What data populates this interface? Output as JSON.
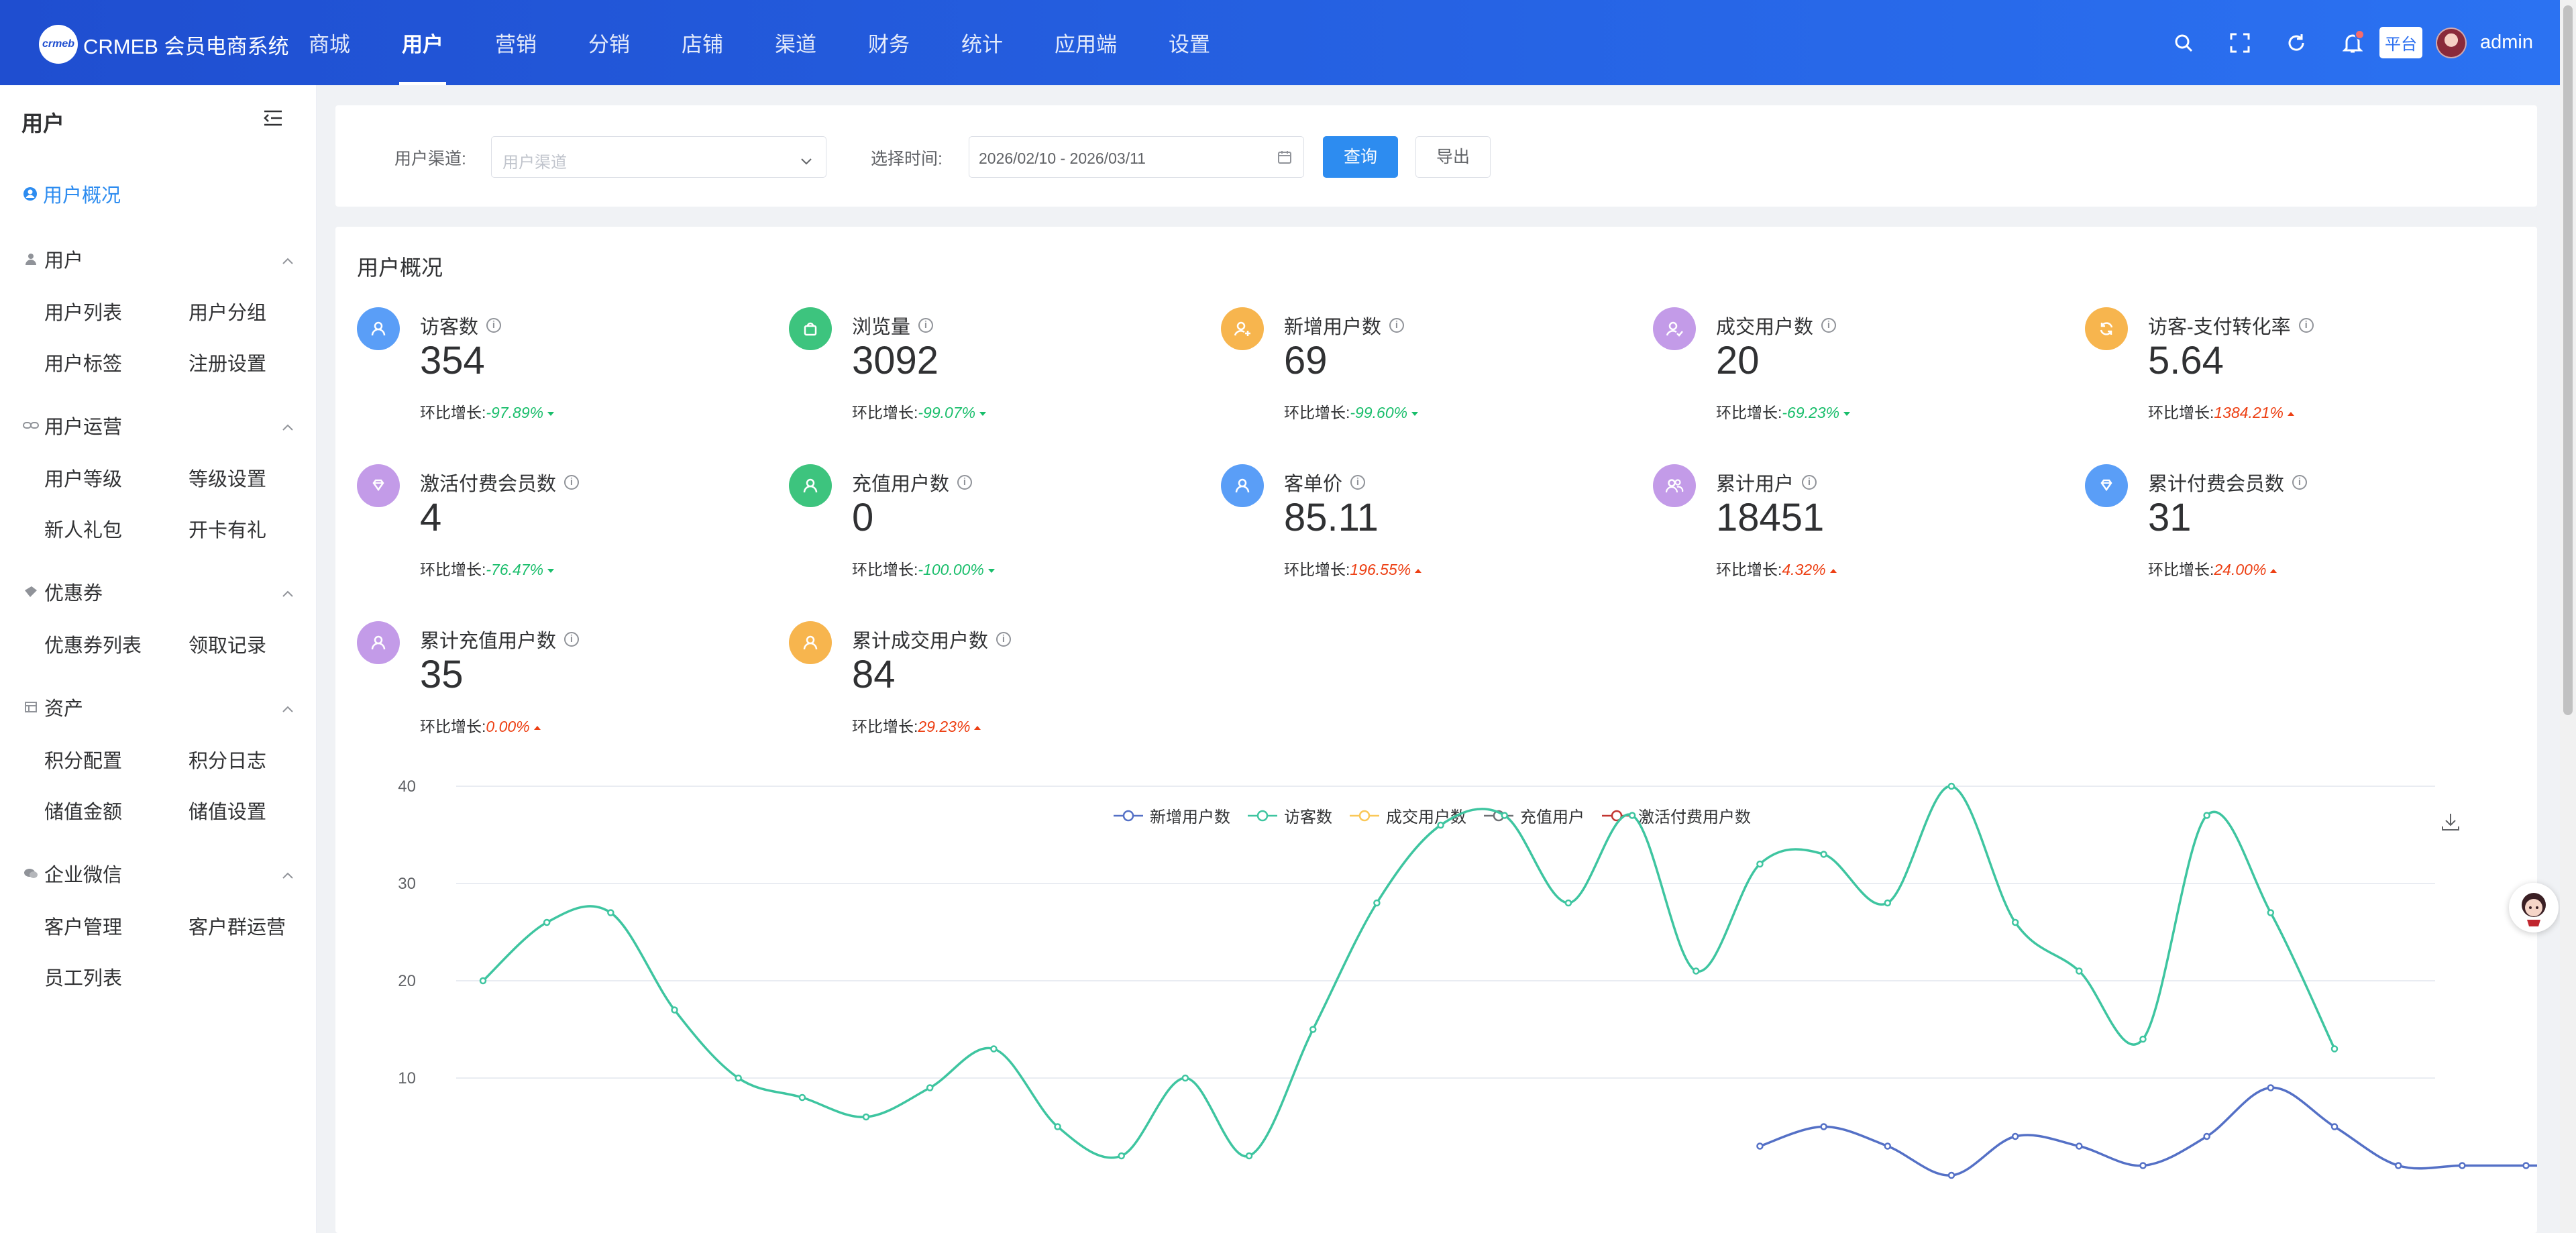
{
  "header": {
    "logo_mark": "crmeb",
    "app_title": "CRMEB 会员电商系统",
    "nav": [
      "商城",
      "用户",
      "营销",
      "分销",
      "店铺",
      "渠道",
      "财务",
      "统计",
      "应用端",
      "设置"
    ],
    "active_nav": "用户",
    "platform_label": "平台",
    "user_name": "admin",
    "brand_color": "#2b6ff0"
  },
  "sidebar": {
    "title": "用户",
    "active_item": "用户概况",
    "groups": [
      {
        "label": "用户",
        "icon": "user-icon",
        "items": [
          "用户列表",
          "用户分组",
          "用户标签",
          "注册设置"
        ]
      },
      {
        "label": "用户运营",
        "icon": "link-icon",
        "items": [
          "用户等级",
          "等级设置",
          "新人礼包",
          "开卡有礼"
        ]
      },
      {
        "label": "优惠券",
        "icon": "ticket-icon",
        "items": [
          "优惠券列表",
          "领取记录"
        ]
      },
      {
        "label": "资产",
        "icon": "wallet-icon",
        "items": [
          "积分配置",
          "积分日志",
          "储值金额",
          "储值设置"
        ]
      },
      {
        "label": "企业微信",
        "icon": "wechat-icon",
        "items": [
          "客户管理",
          "客户群运营",
          "员工列表"
        ]
      }
    ]
  },
  "filter": {
    "channel_label": "用户渠道:",
    "channel_placeholder": "用户渠道",
    "time_label": "选择时间:",
    "date_range": "2026/02/10 - 2026/03/11",
    "query_button": "查询",
    "export_button": "导出"
  },
  "overview": {
    "title": "用户概况",
    "growth_prefix": "环比增长:",
    "stats": [
      {
        "label": "访客数",
        "value": "354",
        "growth": "-97.89%",
        "dir": "down",
        "icon": "user-icon",
        "color": "#5a9ef7"
      },
      {
        "label": "浏览量",
        "value": "3092",
        "growth": "-99.07%",
        "dir": "down",
        "icon": "bag-icon",
        "color": "#3dc47e"
      },
      {
        "label": "新增用户数",
        "value": "69",
        "growth": "-99.60%",
        "dir": "down",
        "icon": "user-add-icon",
        "color": "#f7b54e"
      },
      {
        "label": "成交用户数",
        "value": "20",
        "growth": "-69.23%",
        "dir": "down",
        "icon": "user-check-icon",
        "color": "#c39be8"
      },
      {
        "label": "访客-支付转化率",
        "value": "5.64",
        "growth": "1384.21%",
        "dir": "up",
        "icon": "refresh-icon",
        "color": "#f7b54e"
      },
      {
        "label": "激活付费会员数",
        "value": "4",
        "growth": "-76.47%",
        "dir": "down",
        "icon": "diamond-icon",
        "color": "#c39be8"
      },
      {
        "label": "充值用户数",
        "value": "0",
        "growth": "-100.00%",
        "dir": "down",
        "icon": "user-icon",
        "color": "#3dc47e"
      },
      {
        "label": "客单价",
        "value": "85.11",
        "growth": "196.55%",
        "dir": "up",
        "icon": "user-icon",
        "color": "#5a9ef7"
      },
      {
        "label": "累计用户",
        "value": "18451",
        "growth": "4.32%",
        "dir": "up",
        "icon": "users-icon",
        "color": "#c39be8"
      },
      {
        "label": "累计付费会员数",
        "value": "31",
        "growth": "24.00%",
        "dir": "up",
        "icon": "diamond-icon",
        "color": "#5a9ef7"
      },
      {
        "label": "累计充值用户数",
        "value": "35",
        "growth": "0.00%",
        "dir": "up",
        "icon": "user-icon",
        "color": "#c39be8"
      },
      {
        "label": "累计成交用户数",
        "value": "84",
        "growth": "29.23%",
        "dir": "up",
        "icon": "user-icon",
        "color": "#f7b54e"
      }
    ]
  },
  "chart_data": {
    "type": "line",
    "y_ticks": [
      10,
      20,
      30,
      40
    ],
    "ylim": [
      0,
      40
    ],
    "series": [
      {
        "name": "新增用户数",
        "color": "#5470c6",
        "values": [
          null,
          null,
          null,
          null,
          null,
          null,
          null,
          null,
          null,
          null,
          null,
          null,
          null,
          null,
          null,
          null,
          null,
          null,
          null,
          null,
          3,
          5,
          3,
          0,
          4,
          3,
          1,
          4,
          9,
          5,
          1,
          1,
          1,
          1,
          1,
          1
        ]
      },
      {
        "name": "访客数",
        "color": "#3ec5a0",
        "values": [
          20,
          26,
          27,
          17,
          10,
          8,
          6,
          9,
          13,
          5,
          2,
          10,
          2,
          15,
          28,
          36,
          37,
          28,
          37,
          21,
          32,
          33,
          28,
          40,
          26,
          21,
          14,
          37,
          27,
          13
        ]
      },
      {
        "name": "成交用户数",
        "color": "#fac858",
        "values": []
      },
      {
        "name": "充值用户",
        "color": "#6e7074",
        "values": []
      },
      {
        "name": "激活付费用户数",
        "color": "#c23531",
        "values": []
      }
    ]
  }
}
